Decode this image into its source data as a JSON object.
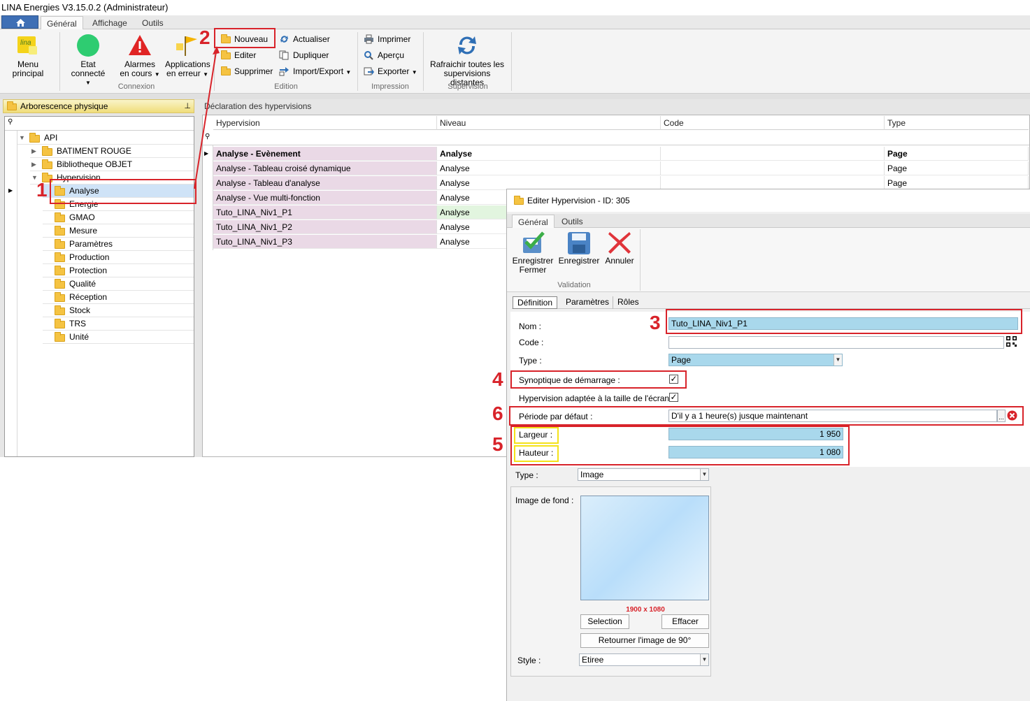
{
  "window": {
    "title": "LINA Energies  V3.15.0.2  (Administrateur)"
  },
  "ribbon": {
    "tabs": [
      "Général",
      "Affichage",
      "Outils"
    ],
    "menu_principal": "Menu principal",
    "etat_connecte": "Etat connecté",
    "alarmes_1": "Alarmes",
    "alarmes_2": "en cours",
    "applications_1": "Applications",
    "applications_2": "en erreur",
    "connexion_label": "Connexion",
    "nouveau": "Nouveau",
    "editer": "Editer",
    "supprimer": "Supprimer",
    "actualiser": "Actualiser",
    "dupliquer": "Dupliquer",
    "import_export": "Import/Export",
    "edition_label": "Edition",
    "imprimer": "Imprimer",
    "apercu": "Aperçu",
    "exporter": "Exporter",
    "impression_label": "Impression",
    "rafraichir_1": "Rafraichir toutes les",
    "rafraichir_2": "supervisions distantes",
    "supervision_label": "Supervision"
  },
  "tree": {
    "title": "Arborescence physique",
    "root": "API",
    "items": [
      "BATIMENT ROUGE",
      "Bibliotheque OBJET",
      "Hypervision",
      "Analyse",
      "Energie",
      "GMAO",
      "Mesure",
      "Paramètres",
      "Production",
      "Protection",
      "Qualité",
      "Réception",
      "Stock",
      "TRS",
      "Unité"
    ]
  },
  "grid": {
    "title": "Déclaration des hypervisions",
    "headers": [
      "Hypervision",
      "Niveau",
      "Code",
      "Type"
    ],
    "rows": [
      [
        "Analyse - Evènement",
        "Analyse",
        "",
        "Page"
      ],
      [
        "Analyse - Tableau croisé dynamique",
        "Analyse",
        "",
        "Page"
      ],
      [
        "Analyse - Tableau d'analyse",
        "Analyse",
        "",
        "Page"
      ],
      [
        "Analyse - Vue multi-fonction",
        "Analyse",
        "",
        ""
      ],
      [
        "Tuto_LINA_Niv1_P1",
        "Analyse",
        "",
        ""
      ],
      [
        "Tuto_LINA_Niv1_P2",
        "Analyse",
        "",
        ""
      ],
      [
        "Tuto_LINA_Niv1_P3",
        "Analyse",
        "",
        ""
      ]
    ]
  },
  "dialog": {
    "title": "Editer Hypervision - ID: 305",
    "tabs": [
      "Général",
      "Outils"
    ],
    "save_close_1": "Enregistrer",
    "save_close_2": "Fermer",
    "save": "Enregistrer",
    "cancel": "Annuler",
    "validation_label": "Validation",
    "subtabs": [
      "Définition",
      "Paramètres",
      "Rôles"
    ],
    "nom_label": "Nom :",
    "nom_value": "Tuto_LINA_Niv1_P1",
    "code_label": "Code :",
    "code_value": "",
    "type_label": "Type :",
    "type_value": "Page",
    "synoptique_label": "Synoptique de démarrage :",
    "adaptee_label": "Hypervision adaptée à la taille de l'écran :",
    "periode_label": "Période par défaut :",
    "periode_value": "D'il y a 1 heure(s) jusque maintenant",
    "largeur_label": "Largeur :",
    "largeur_value": "1 950",
    "hauteur_label": "Hauteur :",
    "hauteur_value": "1 080",
    "type2_label": "Type :",
    "type2_value": "Image",
    "image_label": "Image de fond :",
    "image_size": "1900 x 1080",
    "selection": "Selection",
    "effacer": "Effacer",
    "retourner": "Retourner l'image de 90°",
    "style_label": "Style :",
    "style_value": "Etiree"
  },
  "annotations": [
    "1",
    "2",
    "3",
    "4",
    "5",
    "6"
  ],
  "colors": {
    "annotation_red": "#d8232a",
    "annotation_yellow": "#f4e21a",
    "selected_blue": "#a9d8ec",
    "row_pink": "#ead9e6"
  }
}
